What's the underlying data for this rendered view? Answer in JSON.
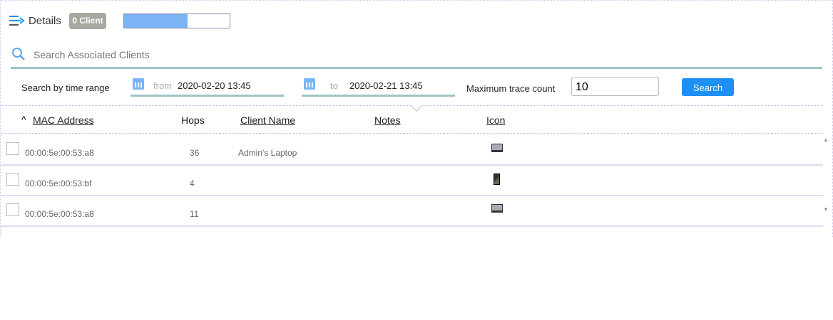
{
  "header": {
    "title": "Details",
    "badge": "0 Client",
    "progress_percent": 60
  },
  "search": {
    "placeholder": "Search Associated Clients"
  },
  "filter": {
    "label": "Search by time range",
    "from_label": "from",
    "from_value": "2020-02-20 13:45",
    "to_label": "to",
    "to_value": "2020-02-21 13:45",
    "max_label": "Maximum trace count",
    "max_value": "10",
    "search_button": "Search"
  },
  "table": {
    "columns": [
      "MAC Address",
      "Hops",
      "Client Name",
      "Notes",
      "Icon"
    ],
    "rows": [
      {
        "mac": "00:00:5e:00:53:a8",
        "hops": "36",
        "name": "Admin's Laptop",
        "notes": "",
        "icon": "laptop-icon"
      },
      {
        "mac": "00:00:5e:00:53:bf",
        "hops": "4",
        "name": "",
        "notes": "",
        "icon": "phone-icon"
      },
      {
        "mac": "00:00:5e:00:53:a8",
        "hops": "11",
        "name": "",
        "notes": "",
        "icon": "laptop-icon"
      }
    ]
  }
}
